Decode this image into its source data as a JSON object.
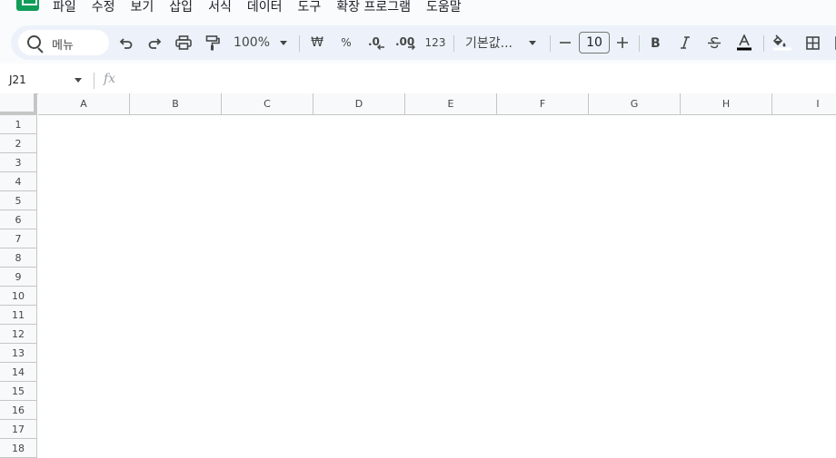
{
  "menu": [
    "파일",
    "수정",
    "보기",
    "삽입",
    "서식",
    "데이터",
    "도구",
    "확장 프로그램",
    "도움말"
  ],
  "toolbar": {
    "search_label": "메뉴",
    "zoom": "100%",
    "currency": "₩",
    "percent": "%",
    "format_123": "123",
    "font": "기본값...",
    "font_size": "10"
  },
  "formula_bar": {
    "name_box": "J21",
    "fx": "fx"
  },
  "columns": [
    "A",
    "B",
    "C",
    "D",
    "E",
    "F",
    "G",
    "H",
    "I"
  ],
  "rows": [
    "1",
    "2",
    "3",
    "4",
    "5",
    "6",
    "7",
    "8",
    "9",
    "10",
    "11",
    "12",
    "13",
    "14",
    "15",
    "16",
    "17",
    "18"
  ],
  "colors": {
    "brand": "#0f9d58",
    "toolbar_bg": "#edf2fa",
    "grid_line": "#c4c7c5",
    "header_bg": "#f8f9fa"
  }
}
